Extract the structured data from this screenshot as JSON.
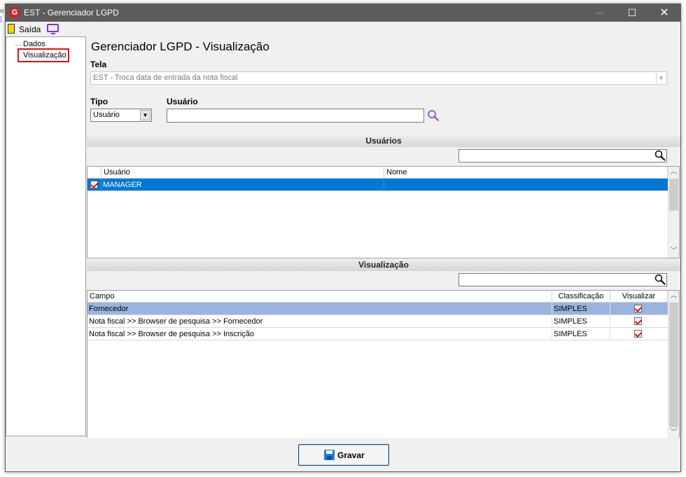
{
  "window": {
    "title": "EST - Gerenciador LGPD",
    "logo_letter": "G"
  },
  "menu": {
    "exit_label": "Saída"
  },
  "tree": {
    "items": [
      {
        "label": "Dados"
      },
      {
        "label": "Visualização"
      }
    ]
  },
  "page": {
    "title": "Gerenciador LGPD - Visualização"
  },
  "tela": {
    "label": "Tela",
    "value": "EST - Troca data de entrada da nota fiscal"
  },
  "tipo": {
    "label": "Tipo",
    "value": "Usuário"
  },
  "usuario": {
    "label": "Usuário",
    "value": ""
  },
  "usuarios_section": {
    "title": "Usuários",
    "filter_value": "",
    "columns": [
      "Usuário",
      "Nome"
    ],
    "rows": [
      {
        "checked": true,
        "usuario": "MANAGER",
        "nome": ""
      }
    ]
  },
  "visualizacao_section": {
    "title": "Visualização",
    "filter_value": "",
    "columns": [
      "Campo",
      "Classificação",
      "Visualizar"
    ],
    "rows": [
      {
        "campo": "Fornecedor",
        "classificacao": "SIMPLES",
        "visualizar": true
      },
      {
        "campo": "Nota fiscal >> Browser de pesquisa >> Fornecedor",
        "classificacao": "SIMPLES",
        "visualizar": true
      },
      {
        "campo": "Nota fiscal >> Browser de pesquisa >> Inscrição",
        "classificacao": "SIMPLES",
        "visualizar": true
      }
    ]
  },
  "footer": {
    "save_label": "Gravar"
  },
  "colors": {
    "selected_row": "#0078d7",
    "highlight_row": "#99b4e1",
    "accent_red": "#e01010",
    "search_icon": "#9b59d6"
  }
}
